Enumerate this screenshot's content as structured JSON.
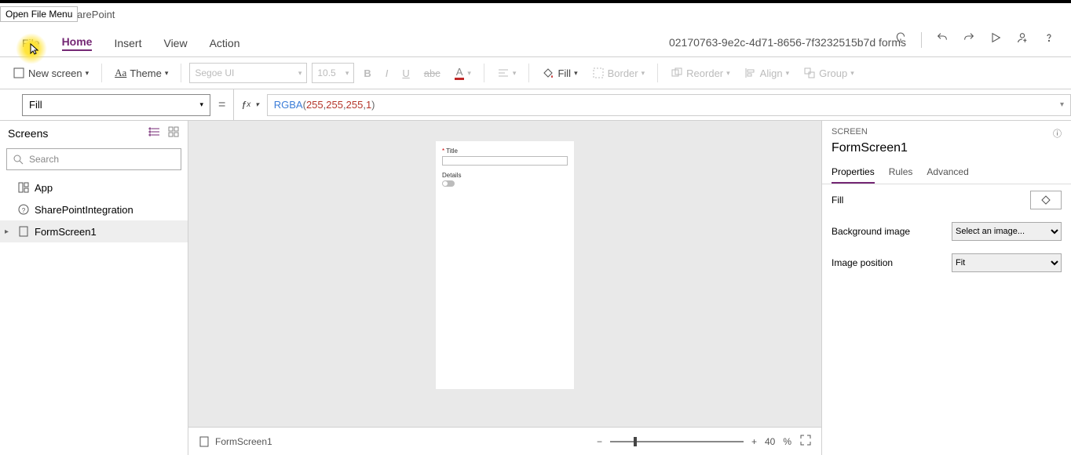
{
  "tooltip": "Open File Menu",
  "breadcrumb": "arePoint",
  "menu": {
    "file": "File",
    "home": "Home",
    "insert": "Insert",
    "view": "View",
    "action": "Action"
  },
  "docname": "02170763-9e2c-4d71-8656-7f3232515b7d forms",
  "ribbon": {
    "newscreen": "New screen",
    "theme": "Theme",
    "font": "Segoe UI",
    "fontsize": "10.5",
    "fill": "Fill",
    "border": "Border",
    "reorder": "Reorder",
    "align": "Align",
    "group": "Group"
  },
  "formula": {
    "property": "Fill",
    "func": "RGBA",
    "args": [
      "255",
      "255",
      "255",
      "1"
    ]
  },
  "tree": {
    "header": "Screens",
    "search_placeholder": "Search",
    "items": [
      {
        "icon": "app",
        "label": "App"
      },
      {
        "icon": "spi",
        "label": "SharePointIntegration"
      },
      {
        "icon": "screen",
        "label": "FormScreen1",
        "selected": true
      }
    ]
  },
  "canvas": {
    "title_label": "Title",
    "details_label": "Details"
  },
  "props": {
    "caption": "SCREEN",
    "name": "FormScreen1",
    "tabs": {
      "properties": "Properties",
      "rules": "Rules",
      "advanced": "Advanced"
    },
    "rows": {
      "fill": "Fill",
      "bg": "Background image",
      "bg_val": "Select an image...",
      "pos": "Image position",
      "pos_val": "Fit"
    }
  },
  "status": {
    "screen": "FormScreen1",
    "zoom": "40",
    "pct": "%"
  }
}
